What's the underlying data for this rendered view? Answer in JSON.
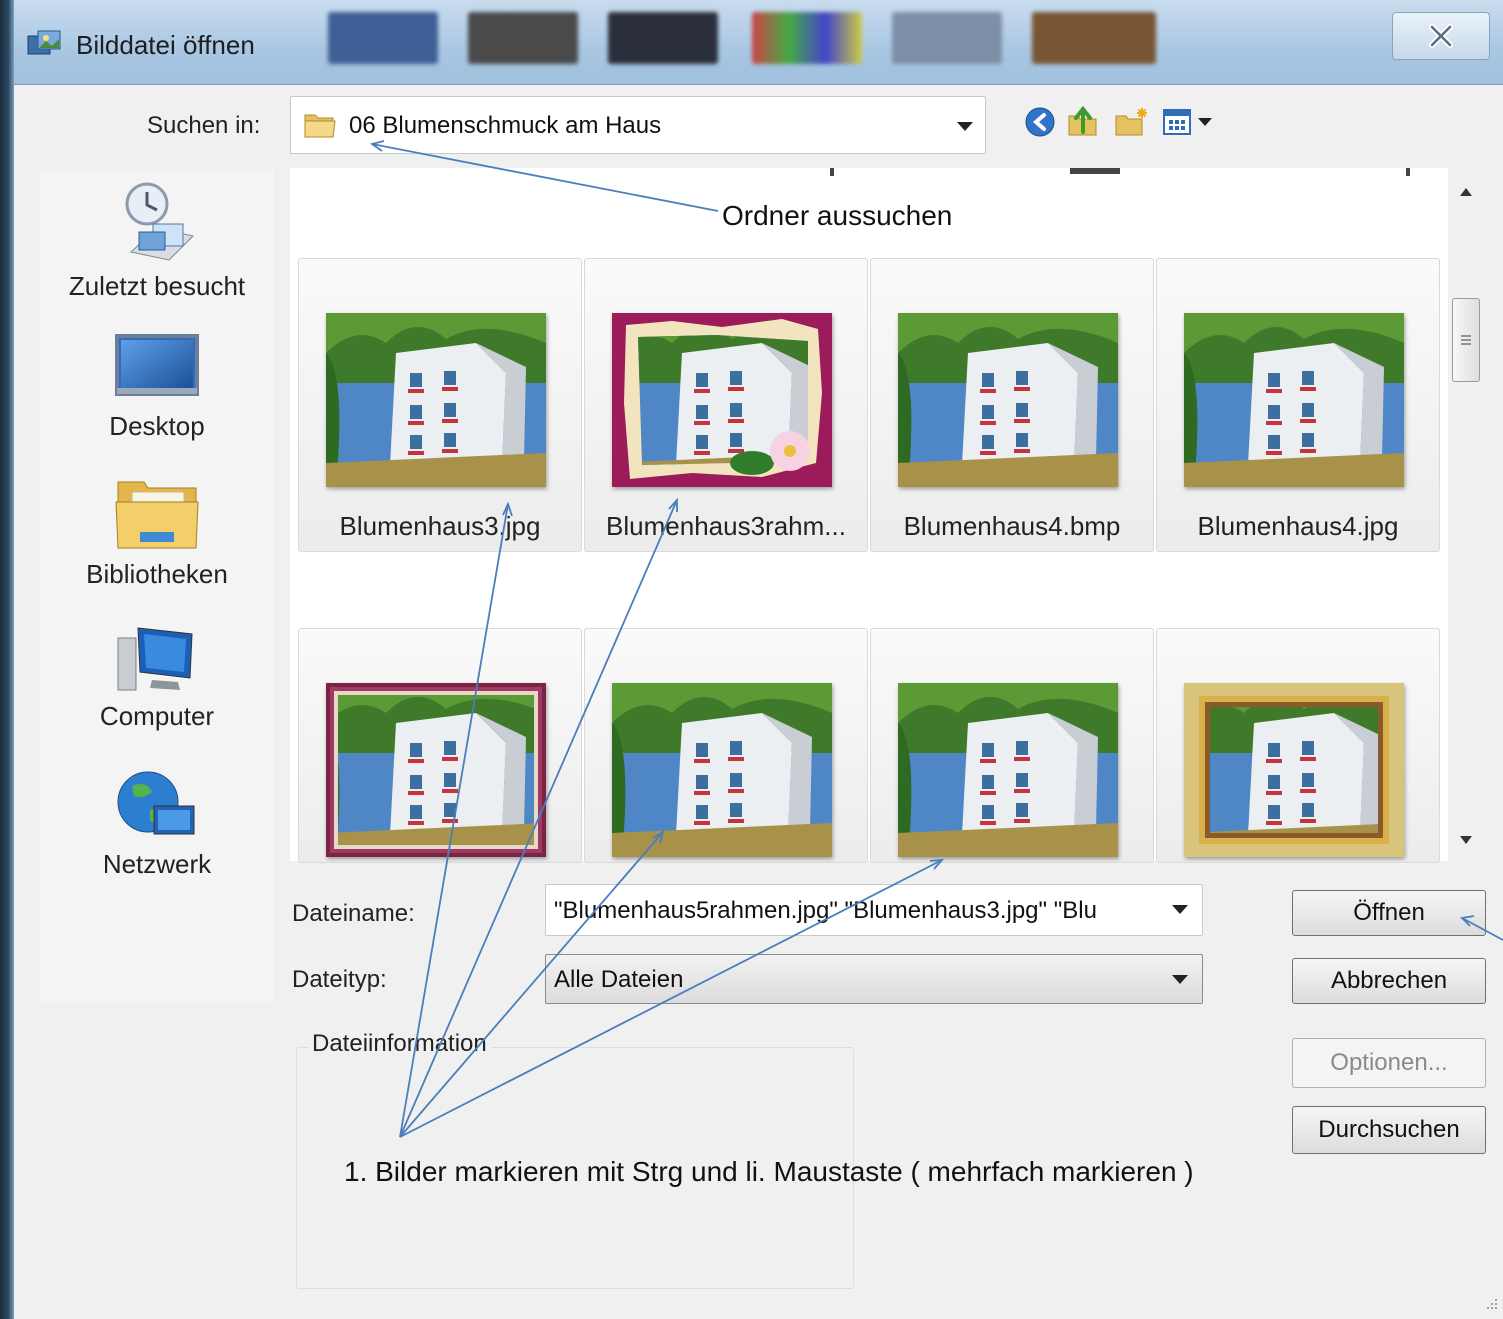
{
  "window": {
    "title": "Bilddatei öffnen",
    "close_glyph": "✕"
  },
  "toolbar": {
    "look_in_label": "Suchen in:",
    "look_in_value": "06 Blumenschmuck am Haus",
    "back_icon": "back-arrow-icon",
    "up_icon": "up-folder-icon",
    "new_folder_icon": "new-folder-icon",
    "view_icon": "view-menu-icon"
  },
  "places": [
    {
      "label": "Zuletzt besucht",
      "icon": "recent-places-icon"
    },
    {
      "label": "Desktop",
      "icon": "desktop-icon"
    },
    {
      "label": "Bibliotheken",
      "icon": "libraries-icon"
    },
    {
      "label": "Computer",
      "icon": "computer-icon"
    },
    {
      "label": "Netzwerk",
      "icon": "network-icon"
    }
  ],
  "files": [
    {
      "name": "Blumenhaus3.jpg",
      "style": "plain"
    },
    {
      "name": "Blumenhaus3rahm...",
      "style": "torn-magenta"
    },
    {
      "name": "Blumenhaus4.bmp",
      "style": "plain"
    },
    {
      "name": "Blumenhaus4.jpg",
      "style": "plain"
    },
    {
      "name": "",
      "style": "magenta-frame"
    },
    {
      "name": "",
      "style": "plain"
    },
    {
      "name": "",
      "style": "plain"
    },
    {
      "name": "",
      "style": "gold-frame"
    }
  ],
  "form": {
    "filename_label": "Dateiname:",
    "filename_value": "\"Blumenhaus5rahmen.jpg\" \"Blumenhaus3.jpg\" \"Blu",
    "filetype_label": "Dateityp:",
    "filetype_value": "Alle Dateien",
    "fileinfo_label": "Dateiinformation"
  },
  "buttons": {
    "open": "Öffnen",
    "cancel": "Abbrechen",
    "options": "Optionen...",
    "browse": "Durchsuchen"
  },
  "annotations": {
    "folder_hint": "Ordner aussuchen",
    "select_hint": "1. Bilder markieren mit Strg und li. Maustaste  ( mehrfach markieren )"
  },
  "colors": {
    "arrow": "#4a7ebb",
    "frame_blue": "#a9c7e3",
    "magenta": "#9c1b5a",
    "gold": "#c9a43a"
  }
}
